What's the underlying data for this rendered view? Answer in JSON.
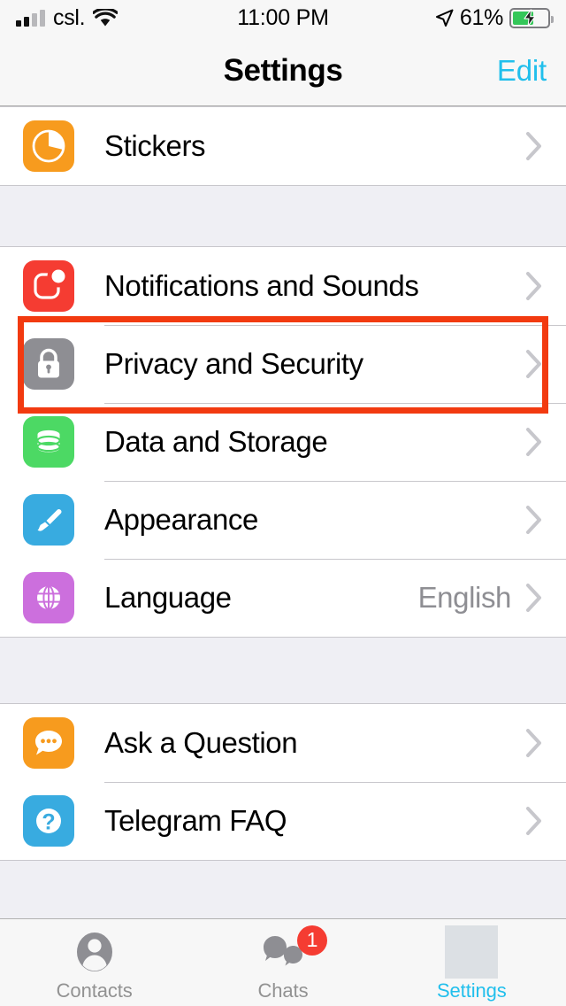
{
  "status_bar": {
    "carrier": "csl.",
    "time": "11:00 PM",
    "battery_percent": "61%",
    "battery_level": 61,
    "signal_bars_filled": 2,
    "signal_bars_total": 4,
    "wifi_icon": "wifi-icon",
    "location_icon": "location-arrow-icon",
    "battery_icon": "battery-charging-icon"
  },
  "nav_bar": {
    "title": "Settings",
    "edit_label": "Edit"
  },
  "sections": [
    {
      "id": "stickers-section",
      "rows": [
        {
          "id": "stickers",
          "label": "Stickers",
          "icon": "stickers-icon",
          "icon_color": "#F79B1E",
          "value": "",
          "chevron": true
        }
      ]
    },
    {
      "id": "preferences-section",
      "rows": [
        {
          "id": "notifications-and-sounds",
          "label": "Notifications and Sounds",
          "icon": "notifications-icon",
          "icon_color": "#F53C32",
          "value": "",
          "chevron": true
        },
        {
          "id": "privacy-and-security",
          "label": "Privacy and Security",
          "icon": "lock-icon",
          "icon_color": "#8E8E93",
          "value": "",
          "chevron": true
        },
        {
          "id": "data-and-storage",
          "label": "Data and Storage",
          "icon": "database-icon",
          "icon_color": "#4CD964",
          "value": "",
          "chevron": true
        },
        {
          "id": "appearance",
          "label": "Appearance",
          "icon": "paintbrush-icon",
          "icon_color": "#38ABE0",
          "value": "",
          "chevron": true
        },
        {
          "id": "language",
          "label": "Language",
          "icon": "globe-icon",
          "icon_color": "#CC6FDD",
          "value": "English",
          "chevron": true
        }
      ]
    },
    {
      "id": "help-section",
      "rows": [
        {
          "id": "ask-a-question",
          "label": "Ask a Question",
          "icon": "chat-bubble-icon",
          "icon_color": "#F79B1E",
          "value": "",
          "chevron": true
        },
        {
          "id": "telegram-faq",
          "label": "Telegram FAQ",
          "icon": "question-mark-icon",
          "icon_color": "#38ABE0",
          "value": "",
          "chevron": true
        }
      ]
    }
  ],
  "tab_bar": {
    "tabs": [
      {
        "id": "contacts",
        "label": "Contacts",
        "icon": "person-icon",
        "active": false,
        "badge": ""
      },
      {
        "id": "chats",
        "label": "Chats",
        "icon": "chats-icon",
        "active": false,
        "badge": "1"
      },
      {
        "id": "settings",
        "label": "Settings",
        "icon": "settings-icon",
        "active": true,
        "badge": ""
      }
    ]
  },
  "annotation": {
    "target": "privacy-and-security",
    "color": "#F23A10"
  }
}
